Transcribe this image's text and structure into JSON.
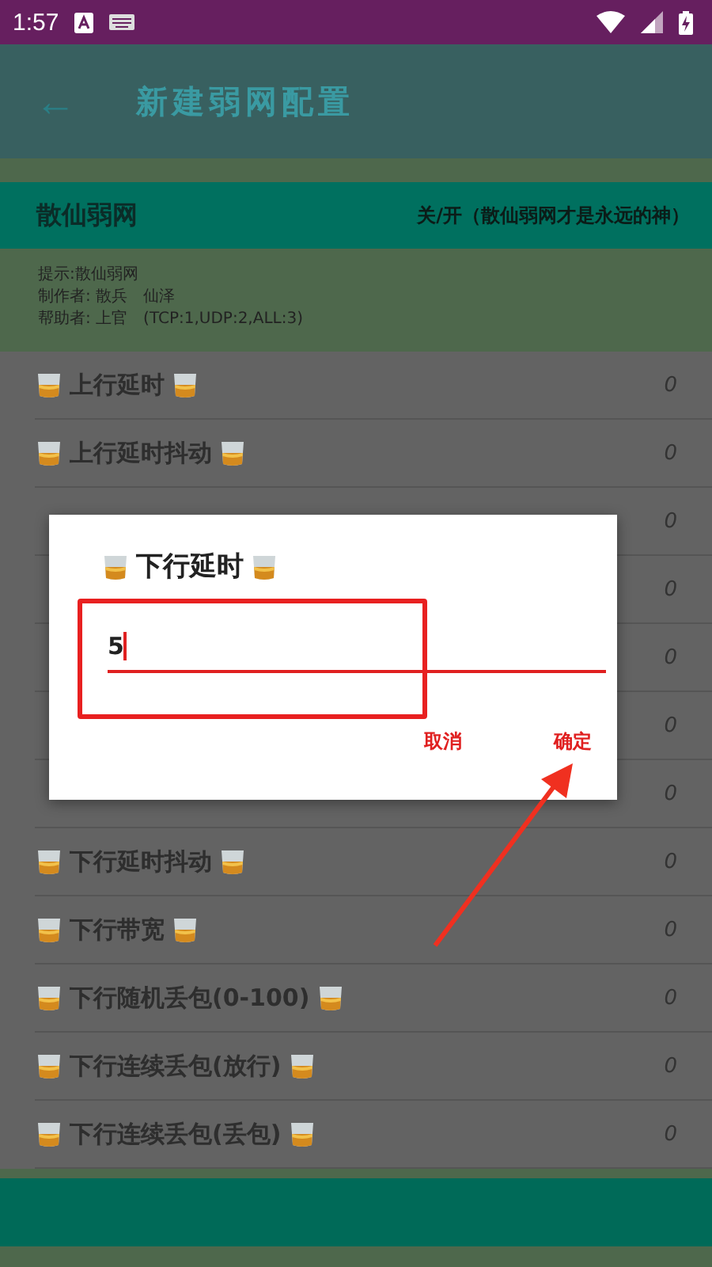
{
  "status_bar": {
    "time": "1:57"
  },
  "toolbar": {
    "back": "←",
    "title": "新建弱网配置"
  },
  "profile": {
    "name": "散仙弱网",
    "toggle_label": "关/开（散仙弱网才是永远的神）"
  },
  "info": [
    "提示:散仙弱网",
    "制作者: 散兵　仙泽",
    "帮助者: 上官　(TCP:1,UDP:2,ALL:3)"
  ],
  "rows": [
    {
      "label": "上行延时",
      "value": "0"
    },
    {
      "label": "上行延时抖动",
      "value": "0"
    },
    {
      "value": "0"
    },
    {
      "value": "0"
    },
    {
      "value": "0"
    },
    {
      "value": "0"
    },
    {
      "value": "0"
    },
    {
      "label": "下行延时抖动",
      "value": "0"
    },
    {
      "label": "下行带宽",
      "value": "0"
    },
    {
      "label": "下行随机丢包(0-100)",
      "value": "0"
    },
    {
      "label": "下行连续丢包(放行)",
      "value": "0"
    },
    {
      "label": "下行连续丢包(丢包)",
      "value": "0"
    }
  ],
  "dialog": {
    "title": "下行延时",
    "value": "5",
    "buttons": [
      "取消",
      "确定"
    ]
  }
}
